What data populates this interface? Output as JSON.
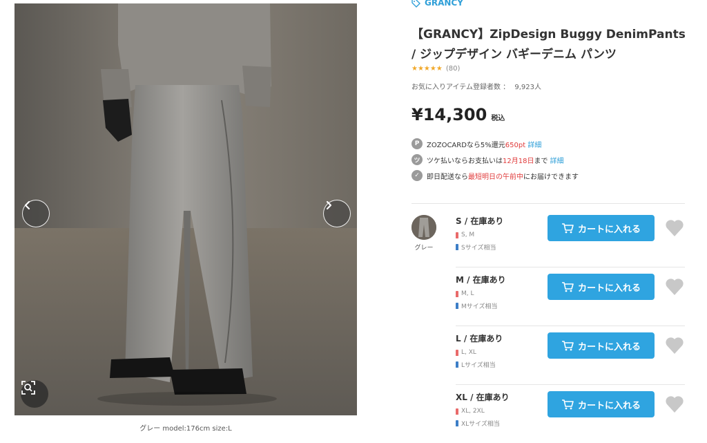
{
  "product": {
    "brand": "GRANCY",
    "title": "【GRANCY】ZipDesign Buggy DenimPants / ジップデザイン バギーデニム パンツ",
    "rating_count": "(80)",
    "stars": "★★★★★",
    "rating_value": 4.5,
    "favorites_label": "お気に入りアイテム登録者数 ：",
    "favorites_count": "9,923人",
    "price": "¥14,300",
    "tax_label": "税込"
  },
  "image": {
    "caption": "グレー model:176cm size:L",
    "prev_icon": "chevron-left-icon",
    "next_icon": "chevron-right-icon",
    "zoom_icon": "zoom-search-icon"
  },
  "perks": [
    {
      "icon": "P",
      "text_a": "ZOZOCARDなら5%還元",
      "highlight": "650pt",
      "text_b": " ",
      "link": "詳細"
    },
    {
      "icon": "ツ",
      "text_a": "ツケ払いならお支払いは",
      "highlight": "12月18日",
      "text_b": "まで ",
      "link": "詳細"
    },
    {
      "icon": "✓",
      "text_a": "即日配送なら",
      "highlight": "最短明日の午前中",
      "text_b": "にお届けできます",
      "link": ""
    }
  ],
  "color": {
    "name": "グレー"
  },
  "sizes": [
    {
      "name": "S / 在庫あり",
      "female": "S, M",
      "male": "Sサイズ相当",
      "button": "カートに入れる"
    },
    {
      "name": "M / 在庫あり",
      "female": "M, L",
      "male": "Mサイズ相当",
      "button": "カートに入れる"
    },
    {
      "name": "L / 在庫あり",
      "female": "L, XL",
      "male": "Lサイズ相当",
      "button": "カートに入れる"
    },
    {
      "name": "XL / 在庫あり",
      "female": "XL, 2XL",
      "male": "XLサイズ相当",
      "button": "カートに入れる"
    }
  ],
  "colors": {
    "accent": "#2fa4e0",
    "highlight_red": "#e03a3a",
    "star": "#f1a829",
    "heart": "#c8c8c8"
  }
}
